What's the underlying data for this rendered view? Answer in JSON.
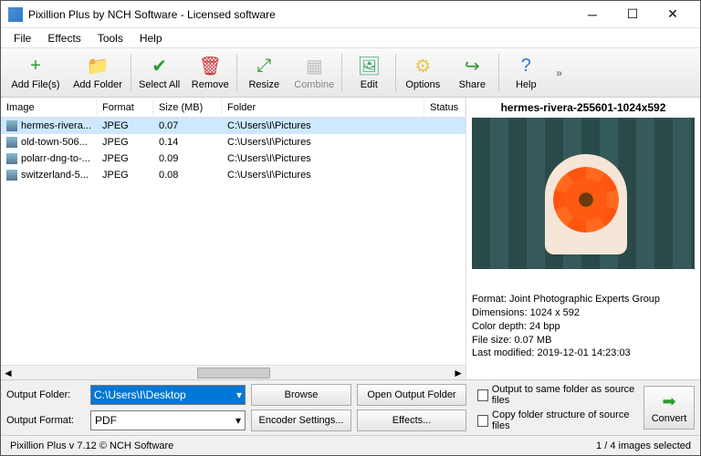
{
  "window": {
    "title": "Pixillion Plus by NCH Software - Licensed software"
  },
  "menu": [
    "File",
    "Effects",
    "Tools",
    "Help"
  ],
  "toolbar": [
    {
      "label": "Add File(s)",
      "icon": "+",
      "color": "#2a9d2a",
      "wide": true
    },
    {
      "label": "Add Folder",
      "icon": "📁",
      "color": "#e6b84c",
      "wide": true
    },
    "sep",
    {
      "label": "Select All",
      "icon": "✔",
      "color": "#2a9d2a"
    },
    {
      "label": "Remove",
      "icon": "🗑",
      "color": "#cc3333"
    },
    "sep",
    {
      "label": "Resize",
      "icon": "⤢",
      "color": "#2a9d2a"
    },
    {
      "label": "Combine",
      "icon": "▦",
      "color": "#888",
      "disabled": true
    },
    "sep",
    {
      "label": "Edit",
      "icon": "🖼",
      "color": "#4a7"
    },
    "sep",
    {
      "label": "Options",
      "icon": "⚙",
      "color": "#e6c84c"
    },
    {
      "label": "Share",
      "icon": "↪",
      "color": "#2a9d2a"
    },
    "sep",
    {
      "label": "Help",
      "icon": "?",
      "color": "#2a7ad9"
    }
  ],
  "columns": [
    "Image",
    "Format",
    "Size (MB)",
    "Folder",
    "Status"
  ],
  "rows": [
    {
      "image": "hermes-rivera...",
      "format": "JPEG",
      "size": "0.07",
      "folder": "C:\\Users\\I\\Pictures",
      "status": "",
      "selected": true
    },
    {
      "image": "old-town-506...",
      "format": "JPEG",
      "size": "0.14",
      "folder": "C:\\Users\\I\\Pictures",
      "status": ""
    },
    {
      "image": "polarr-dng-to-...",
      "format": "JPEG",
      "size": "0.09",
      "folder": "C:\\Users\\I\\Pictures",
      "status": ""
    },
    {
      "image": "switzerland-5...",
      "format": "JPEG",
      "size": "0.08",
      "folder": "C:\\Users\\I\\Pictures",
      "status": ""
    }
  ],
  "preview": {
    "name": "hermes-rivera-255601-1024x592",
    "meta": {
      "format": "Format: Joint Photographic Experts Group",
      "dimensions": "Dimensions: 1024 x 592",
      "depth": "Color depth: 24 bpp",
      "size": "File size: 0.07 MB",
      "modified": "Last modified: 2019-12-01 14:23:03"
    }
  },
  "output": {
    "folder_label": "Output Folder:",
    "folder_value": "C:\\Users\\I\\Desktop",
    "browse": "Browse",
    "open": "Open Output Folder",
    "format_label": "Output Format:",
    "format_value": "PDF",
    "encoder": "Encoder Settings...",
    "effects": "Effects..."
  },
  "options": {
    "same_folder": "Output to same folder as source files",
    "copy_structure": "Copy folder structure of source files"
  },
  "convert": "Convert",
  "status": {
    "left": "Pixillion Plus v 7.12 © NCH Software",
    "right": "1 / 4 images selected"
  }
}
